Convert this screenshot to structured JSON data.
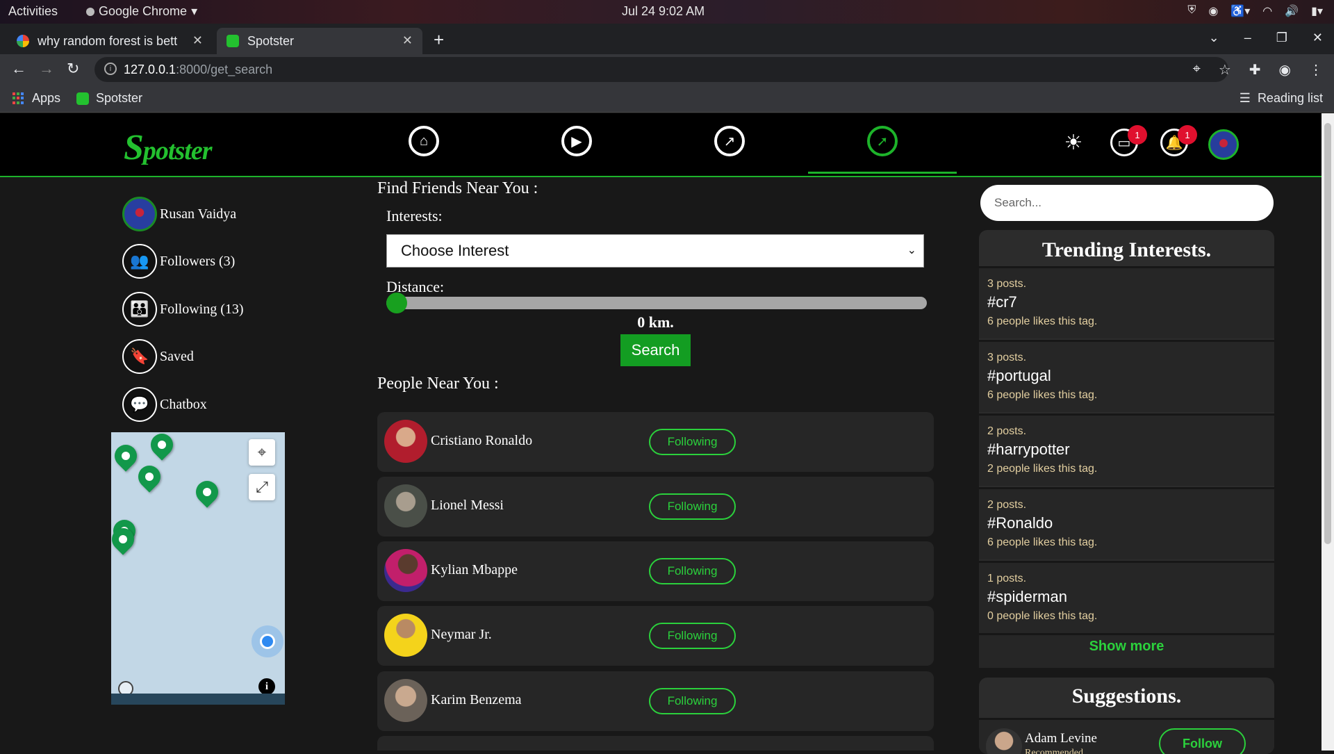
{
  "os": {
    "activities": "Activities",
    "app_name": "Google Chrome",
    "clock": "Jul 24  9:02 AM"
  },
  "browser": {
    "tabs": [
      {
        "title": "why random forest is bett",
        "favicon": "google-icon"
      },
      {
        "title": "Spotster",
        "favicon": "spotster-icon"
      }
    ],
    "url_host": "127.0.0.1",
    "url_path": ":8000/get_search",
    "bookmarks": {
      "apps": "Apps",
      "spotster": "Spotster",
      "reading_list": "Reading list"
    }
  },
  "site": {
    "logo": "potster",
    "logo_initial": "S",
    "nav": [
      "home-icon",
      "play-icon",
      "trending-icon",
      "explore-icon"
    ],
    "badges": {
      "messages": "1",
      "notifications": "1"
    },
    "colors": {
      "accent": "#1db32a",
      "badge": "#e0102e",
      "background": "#181818"
    }
  },
  "sidebar": {
    "user_name": "Rusan Vaidya",
    "items": [
      {
        "label": "Followers (3)",
        "icon": "followers-icon"
      },
      {
        "label": "Following (13)",
        "icon": "following-icon"
      },
      {
        "label": "Saved",
        "icon": "bookmark-icon"
      },
      {
        "label": "Chatbox",
        "icon": "chat-icon"
      }
    ]
  },
  "main": {
    "find_title": "Find Friends Near You :",
    "interests_label": "Interests:",
    "interest_selected": "Choose Interest",
    "distance_label": "Distance:",
    "distance_value": "0 km.",
    "distance_level": 0,
    "search_label": "Search",
    "people_title": "People Near You :",
    "people": [
      {
        "name": "Cristiano Ronaldo",
        "status": "Following"
      },
      {
        "name": "Lionel Messi",
        "status": "Following"
      },
      {
        "name": "Kylian Mbappe",
        "status": "Following"
      },
      {
        "name": "Neymar Jr.",
        "status": "Following"
      },
      {
        "name": "Karim Benzema",
        "status": "Following"
      }
    ]
  },
  "right": {
    "search_placeholder": "Search...",
    "trending_title": "Trending Interests.",
    "trends": [
      {
        "posts": "3 posts.",
        "tag": "#cr7",
        "likes": "6 people likes this tag."
      },
      {
        "posts": "3 posts.",
        "tag": "#portugal",
        "likes": "6 people likes this tag."
      },
      {
        "posts": "2 posts.",
        "tag": "#harrypotter",
        "likes": "2 people likes this tag."
      },
      {
        "posts": "2 posts.",
        "tag": "#Ronaldo",
        "likes": "6 people likes this tag."
      },
      {
        "posts": "1 posts.",
        "tag": "#spiderman",
        "likes": "0 people likes this tag."
      }
    ],
    "show_more": "Show more",
    "suggestions_title": "Suggestions.",
    "suggestion": {
      "name": "Adam Levine",
      "sub": "Recommended",
      "button": "Follow"
    }
  }
}
